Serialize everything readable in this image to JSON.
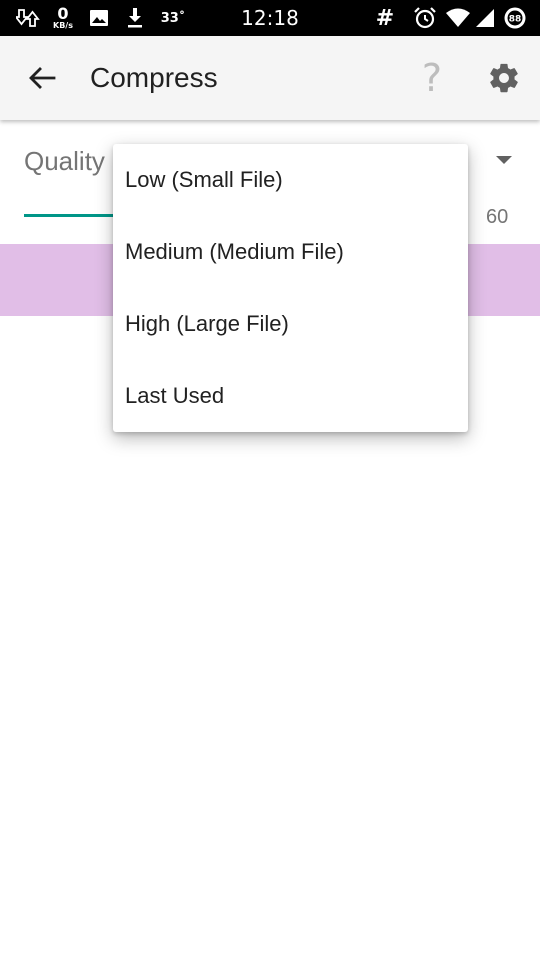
{
  "status_bar": {
    "net_speed_value": "0",
    "net_speed_unit": "KB/s",
    "temperature": "33˚",
    "time": "12:18",
    "hash_icon": "#",
    "battery_level": "88",
    "icons": [
      "data-saver-icon",
      "image-icon",
      "download-icon",
      "hash-icon",
      "alarm-icon",
      "wifi-icon",
      "signal-icon",
      "battery-icon"
    ]
  },
  "app_bar": {
    "title": "Compress",
    "help_glyph": "?",
    "icons": [
      "back-arrow-icon",
      "help-icon",
      "settings-gear-icon"
    ]
  },
  "quality": {
    "label": "Quality",
    "value": "60",
    "accent_color": "#009688",
    "band_color": "#e1bee7"
  },
  "dropdown": {
    "options": [
      "Low (Small File)",
      "Medium (Medium File)",
      "High (Large File)",
      "Last Used"
    ]
  }
}
